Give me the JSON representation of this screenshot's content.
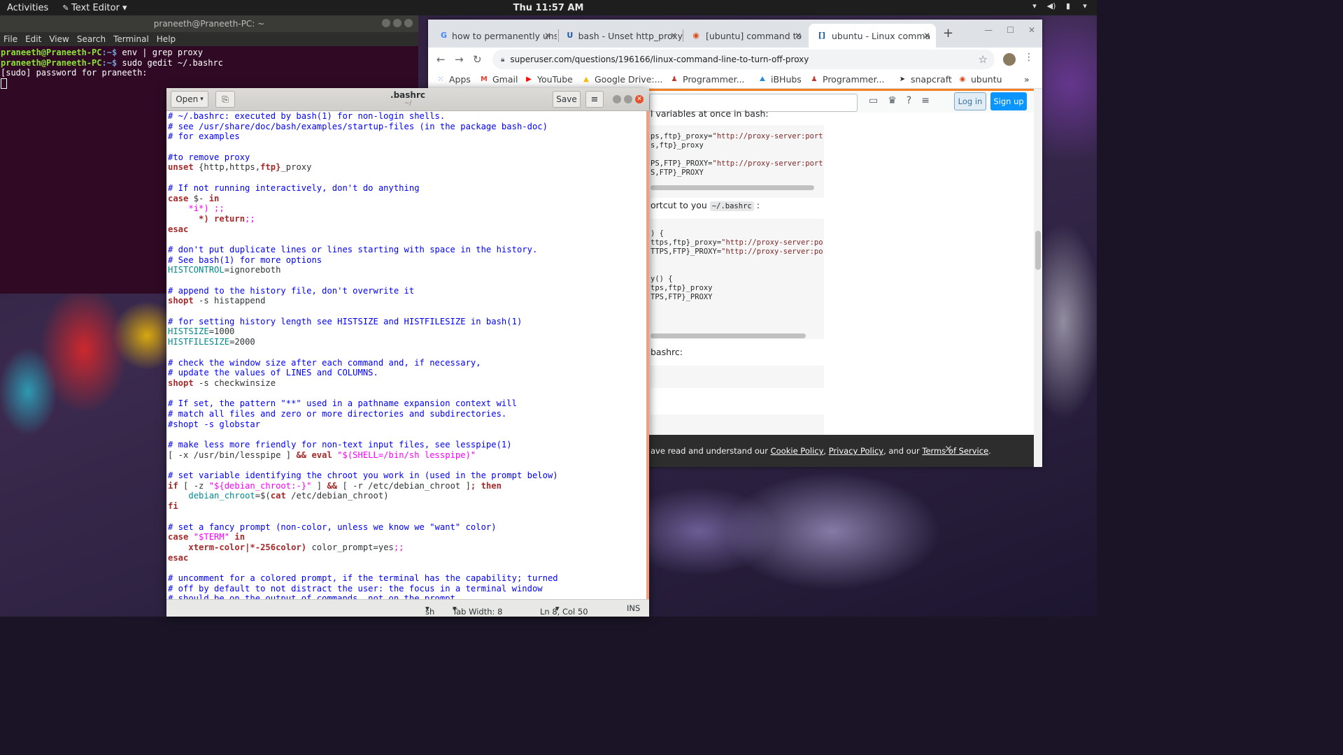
{
  "topbar": {
    "activities": "Activities",
    "app_menu": "Text Editor ▾",
    "clock": "Thu 11:57 AM"
  },
  "terminal": {
    "title": "praneeth@Praneeth-PC: ~",
    "menu": [
      "File",
      "Edit",
      "View",
      "Search",
      "Terminal",
      "Help"
    ],
    "prompt_user": "praneeth@Praneeth-PC",
    "prompt_path": ":~$",
    "commands": [
      " env | grep proxy",
      " sudo gedit ~/.bashrc"
    ],
    "sudo_line": "[sudo] password for praneeth:"
  },
  "browser": {
    "tabs": [
      {
        "label": "how to permanently unset",
        "icon": "G",
        "icon_color": "#4285f4"
      },
      {
        "label": "bash - Unset http_proxy",
        "icon": "U",
        "icon_color": "#1e5ba8"
      },
      {
        "label": "[ubuntu] command to",
        "icon": "◉",
        "icon_color": "#dd4814"
      },
      {
        "label": "ubuntu - Linux comma",
        "icon": "[]",
        "icon_color": "#1e5ba8"
      }
    ],
    "new_tab": "+",
    "url": "superuser.com/questions/196166/linux-command-line-to-turn-off-proxy",
    "bookmarks": [
      {
        "label": "Apps",
        "icon": "apps-grid-icon",
        "color": "#4285f4"
      },
      {
        "label": "Gmail",
        "icon": "gmail-icon",
        "color": "#ea4335"
      },
      {
        "label": "YouTube",
        "icon": "youtube-icon",
        "color": "#ff0000"
      },
      {
        "label": "Google Drive:...",
        "icon": "drive-icon",
        "color": "#fbbc04"
      },
      {
        "label": "Programmer...",
        "icon": "programmer-icon",
        "color": "#c0392b"
      },
      {
        "label": "iBHubs",
        "icon": "ibhubs-icon",
        "color": "#2a8bd8"
      },
      {
        "label": "Programmer...",
        "icon": "programmer-icon",
        "color": "#c0392b"
      },
      {
        "label": "snapcraft",
        "icon": "snapcraft-icon",
        "color": "#222"
      },
      {
        "label": "ubuntu",
        "icon": "ubuntu-icon",
        "color": "#dd4814"
      }
    ],
    "more": "»",
    "page": {
      "login": "Log in",
      "signup": "Sign up",
      "text_top": "l variables at once in bash:",
      "code1": [
        "ps,ftp}_proxy=\"http://proxy-server:port",
        "s,ftp}_proxy",
        "",
        "PS,FTP}_PROXY=\"http://proxy-server:port",
        "S,FTP}_PROXY"
      ],
      "text_shortcut_pre": "ortcut to you ",
      "text_shortcut_code": "~/.bashrc",
      "text_shortcut_post": " :",
      "code2": [
        "",
        ") {",
        "ttps,ftp}_proxy=\"http://proxy-server:po",
        "TTPS,FTP}_PROXY=\"http://proxy-server:po",
        "",
        "",
        "y() {",
        "tps,ftp}_proxy",
        "TPS,FTP}_PROXY"
      ],
      "text_bashrc": "bashrc:",
      "cookie_pre": "ave read and understand our ",
      "cookie_link1": "Cookie Policy",
      "cookie_sep1": ", ",
      "cookie_link2": "Privacy Policy",
      "cookie_sep2": ", and our ",
      "cookie_link3": "Terms of Service",
      "cookie_end": ".",
      "cookie_close": "✕"
    }
  },
  "gedit": {
    "open": "Open",
    "title": ".bashrc",
    "subtitle": "~/",
    "save": "Save",
    "status": {
      "lang": "sh",
      "tab_width": "Tab Width: 8",
      "position": "Ln 8, Col 50",
      "mode": "INS"
    },
    "lines": [
      [
        [
          "c",
          "# ~/.bashrc: executed by bash(1) for non-login shells."
        ]
      ],
      [
        [
          "c",
          "# see /usr/share/doc/bash/examples/startup-files (in the package bash-doc)"
        ]
      ],
      [
        [
          "c",
          "# for examples"
        ]
      ],
      [
        [
          "t",
          ""
        ]
      ],
      [
        [
          "c",
          "#to remove proxy"
        ]
      ],
      [
        [
          "k",
          "unset "
        ],
        [
          "t",
          "{http,https,"
        ],
        [
          "k",
          "ftp}"
        ],
        [
          "t",
          "_proxy"
        ]
      ],
      [
        [
          "t",
          ""
        ]
      ],
      [
        [
          "c",
          "# If not running interactively, don't do anything"
        ]
      ],
      [
        [
          "k",
          "case "
        ],
        [
          "t",
          "$- "
        ],
        [
          "k",
          "in"
        ]
      ],
      [
        [
          "t",
          "    "
        ],
        [
          "s",
          "*i*) ;;"
        ]
      ],
      [
        [
          "t",
          "      "
        ],
        [
          "k",
          "*) return"
        ],
        [
          "s",
          ";;"
        ]
      ],
      [
        [
          "k",
          "esac"
        ]
      ],
      [
        [
          "t",
          ""
        ]
      ],
      [
        [
          "c",
          "# don't put duplicate lines or lines starting with space in the history."
        ]
      ],
      [
        [
          "c",
          "# See bash(1) for more options"
        ]
      ],
      [
        [
          "v",
          "HISTCONTROL"
        ],
        [
          "t",
          "=ignoreboth"
        ]
      ],
      [
        [
          "t",
          ""
        ]
      ],
      [
        [
          "c",
          "# append to the history file, don't overwrite it"
        ]
      ],
      [
        [
          "k",
          "shopt "
        ],
        [
          "t",
          "-s histappend"
        ]
      ],
      [
        [
          "t",
          ""
        ]
      ],
      [
        [
          "c",
          "# for setting history length see HISTSIZE and HISTFILESIZE in bash(1)"
        ]
      ],
      [
        [
          "v",
          "HISTSIZE"
        ],
        [
          "t",
          "=1000"
        ]
      ],
      [
        [
          "v",
          "HISTFILESIZE"
        ],
        [
          "t",
          "=2000"
        ]
      ],
      [
        [
          "t",
          ""
        ]
      ],
      [
        [
          "c",
          "# check the window size after each command and, if necessary,"
        ]
      ],
      [
        [
          "c",
          "# update the values of LINES and COLUMNS."
        ]
      ],
      [
        [
          "k",
          "shopt "
        ],
        [
          "t",
          "-s checkwinsize"
        ]
      ],
      [
        [
          "t",
          ""
        ]
      ],
      [
        [
          "c",
          "# If set, the pattern \"**\" used in a pathname expansion context will"
        ]
      ],
      [
        [
          "c",
          "# match all files and zero or more directories and subdirectories."
        ]
      ],
      [
        [
          "c",
          "#shopt -s globstar"
        ]
      ],
      [
        [
          "t",
          ""
        ]
      ],
      [
        [
          "c",
          "# make less more friendly for non-text input files, see lesspipe(1)"
        ]
      ],
      [
        [
          "t",
          "[ -x /usr/bin/lesspipe ] "
        ],
        [
          "k",
          "&& eval "
        ],
        [
          "s",
          "\"$(SHELL=/bin/sh lesspipe)\""
        ]
      ],
      [
        [
          "t",
          ""
        ]
      ],
      [
        [
          "c",
          "# set variable identifying the chroot you work in (used in the prompt below)"
        ]
      ],
      [
        [
          "k",
          "if "
        ],
        [
          "t",
          "[ -z "
        ],
        [
          "s",
          "\"${debian_chroot:-}\""
        ],
        [
          "t",
          " ] "
        ],
        [
          "k",
          "&& "
        ],
        [
          "t",
          "[ -r /etc/debian_chroot ]"
        ],
        [
          "k",
          "; then"
        ]
      ],
      [
        [
          "t",
          "    "
        ],
        [
          "v",
          "debian_chroot"
        ],
        [
          "t",
          "=$("
        ],
        [
          "k",
          "cat "
        ],
        [
          "t",
          "/etc/debian_chroot)"
        ]
      ],
      [
        [
          "k",
          "fi"
        ]
      ],
      [
        [
          "t",
          ""
        ]
      ],
      [
        [
          "c",
          "# set a fancy prompt (non-color, unless we know we \"want\" color)"
        ]
      ],
      [
        [
          "k",
          "case "
        ],
        [
          "s",
          "\"$TERM\""
        ],
        [
          "k",
          " in"
        ]
      ],
      [
        [
          "t",
          "    "
        ],
        [
          "k",
          "xterm-color|*-256color) "
        ],
        [
          "t",
          "color_prompt=yes"
        ],
        [
          "s",
          ";;"
        ]
      ],
      [
        [
          "k",
          "esac"
        ]
      ],
      [
        [
          "t",
          ""
        ]
      ],
      [
        [
          "c",
          "# uncomment for a colored prompt, if the terminal has the capability; turned"
        ]
      ],
      [
        [
          "c",
          "# off by default to not distract the user: the focus in a terminal window"
        ]
      ],
      [
        [
          "c",
          "# should be on the output of commands, not on the prompt"
        ]
      ]
    ]
  }
}
